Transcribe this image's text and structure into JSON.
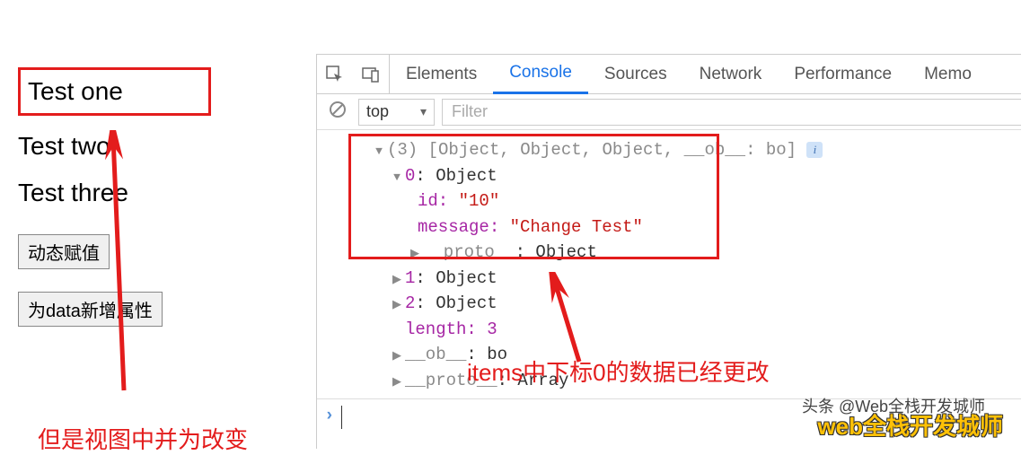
{
  "left": {
    "test1": "Test one",
    "test2": "Test two",
    "test3": "Test three",
    "btn1": "动态赋值",
    "btn2": "为data新增属性",
    "bottom_text": "但是视图中并为改变"
  },
  "devtools": {
    "tabs": [
      "Elements",
      "Console",
      "Sources",
      "Network",
      "Performance",
      "Memo"
    ],
    "active_tab": "Console",
    "context": "top",
    "filter_placeholder": "Filter"
  },
  "console": {
    "top_line": "(3) [Object, Object, Object, __ob__: bo]",
    "obj0": {
      "head": "0: Object",
      "id_key": "id:",
      "id_val": "\"10\"",
      "msg_key": "message:",
      "msg_val": "\"Change Test\"",
      "proto": "__proto__",
      "proto_val": ": Object"
    },
    "obj1": "1: Object",
    "obj2": "2: Object",
    "length_key": "length:",
    "length_val": "3",
    "ob_key": "__ob__",
    "ob_val": ": bo",
    "proto_key": "__proto__",
    "proto_val": ": Array"
  },
  "annotation": "items中下标0的数据已经更改",
  "watermark_small": "头条 @Web全栈开发城师",
  "watermark_big": "web全栈开发城师"
}
